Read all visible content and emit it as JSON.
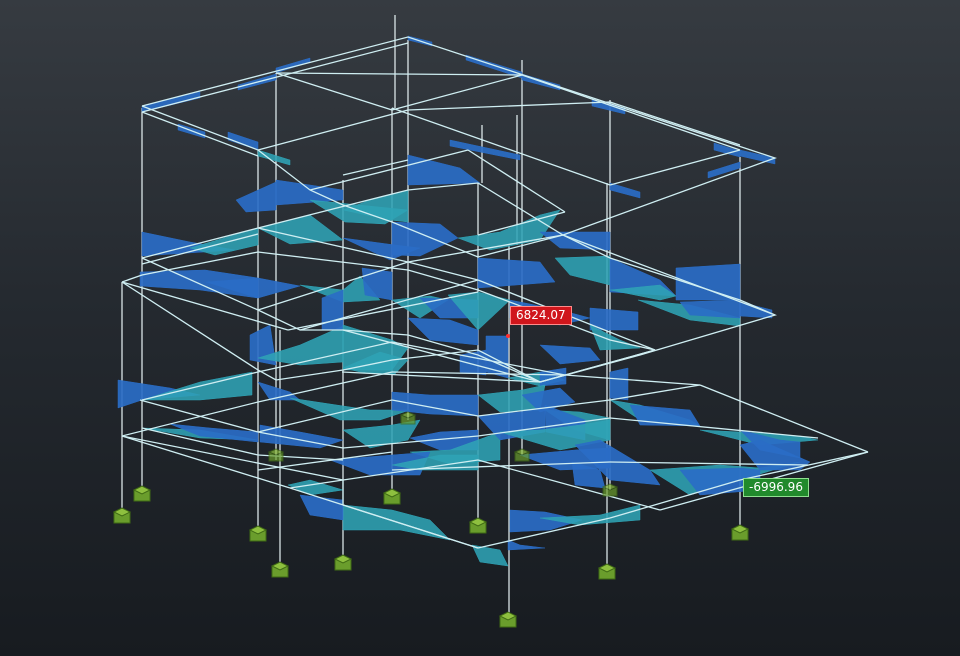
{
  "view": {
    "kind": "3D frame model - bending moment diagram",
    "colors": {
      "background_top": "#363b41",
      "background_bottom": "#171b20",
      "frame_lines": "#cfeef2",
      "diagram_positive": "#2fa3b5",
      "diagram_negative": "#2a6dc6",
      "supports": "#6a9d2c",
      "max_tag": "#d0161c",
      "min_tag": "#218a2c"
    }
  },
  "annotations": {
    "max_value": "6824.07",
    "min_value": "-6996.96"
  }
}
